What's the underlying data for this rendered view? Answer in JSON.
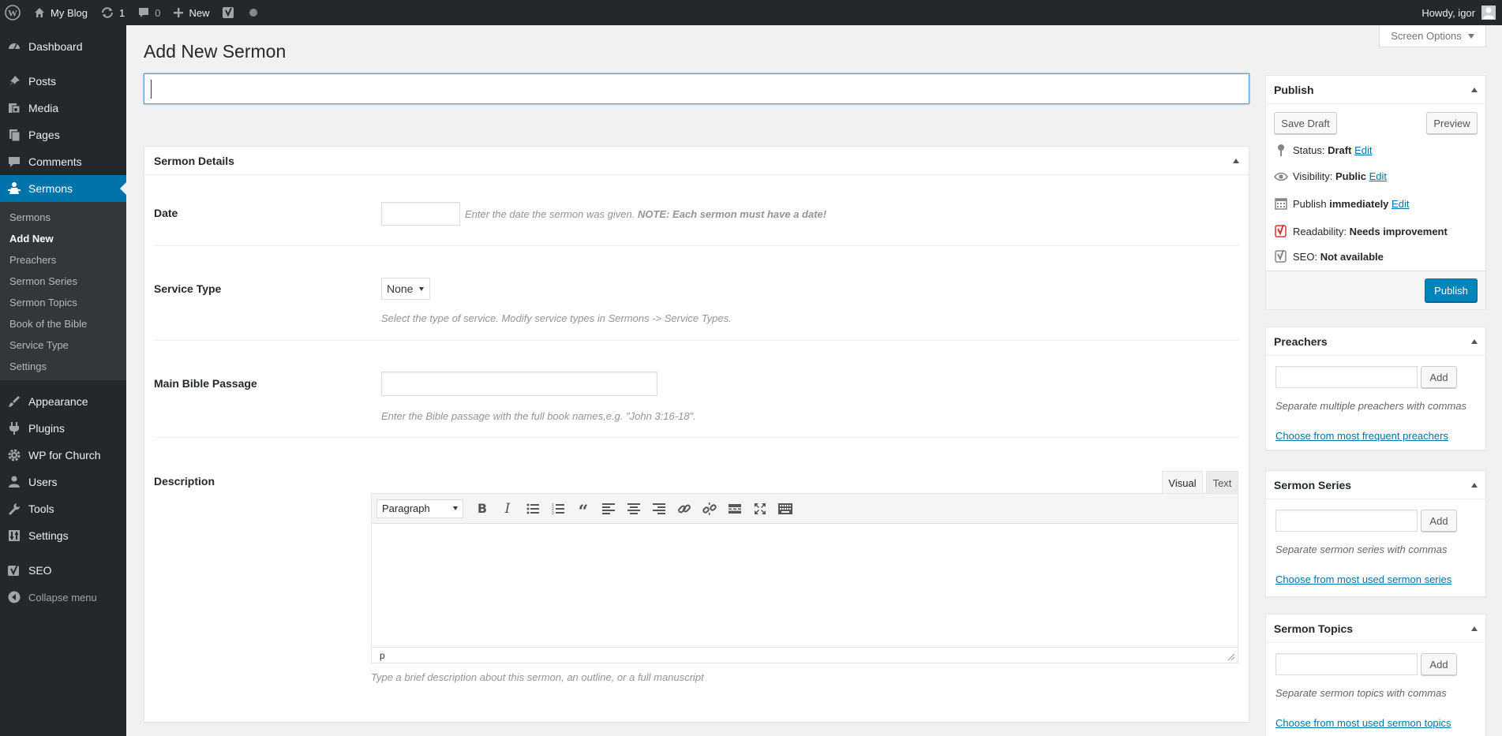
{
  "adminbar": {
    "site_name": "My Blog",
    "updates_count": "1",
    "comments_count": "0",
    "new_label": "New",
    "howdy": "Howdy, igor"
  },
  "sidebar": {
    "items": [
      {
        "label": "Dashboard",
        "icon": "dashboard-icon"
      },
      {
        "label": "Posts",
        "icon": "pin-icon"
      },
      {
        "label": "Media",
        "icon": "media-icon"
      },
      {
        "label": "Pages",
        "icon": "pages-icon"
      },
      {
        "label": "Comments",
        "icon": "comment-icon"
      },
      {
        "label": "Sermons",
        "icon": "person-icon"
      },
      {
        "label": "Appearance",
        "icon": "brush-icon"
      },
      {
        "label": "Plugins",
        "icon": "plugin-icon"
      },
      {
        "label": "WP for Church",
        "icon": "gear-icon"
      },
      {
        "label": "Users",
        "icon": "user-icon"
      },
      {
        "label": "Tools",
        "icon": "wrench-icon"
      },
      {
        "label": "Settings",
        "icon": "settings-icon"
      },
      {
        "label": "SEO",
        "icon": "yoast-icon"
      },
      {
        "label": "Collapse menu",
        "icon": "collapse-icon"
      }
    ],
    "submenu": [
      "Sermons",
      "Add New",
      "Preachers",
      "Sermon Series",
      "Sermon Topics",
      "Book of the Bible",
      "Service Type",
      "Settings"
    ]
  },
  "screen_options": "Screen Options",
  "page_title": "Add New Sermon",
  "title_input": {
    "value": ""
  },
  "details": {
    "title": "Sermon Details",
    "date_label": "Date",
    "date_help": "Enter the date the sermon was given. ",
    "date_help_bold": "NOTE: Each sermon must have a date!",
    "service_label": "Service Type",
    "service_value": "None",
    "service_help": "Select the type of service. Modify service types in Sermons -> Service Types.",
    "passage_label": "Main Bible Passage",
    "passage_help": "Enter the Bible passage with the full book names,e.g. \"John 3:16-18\".",
    "desc_label": "Description",
    "tab_visual": "Visual",
    "tab_text": "Text",
    "format_value": "Paragraph",
    "editor_path": "p",
    "desc_help": "Type a brief description about this sermon, an outline, or a full manuscript"
  },
  "publish": {
    "title": "Publish",
    "save_draft": "Save Draft",
    "preview": "Preview",
    "status_label": "Status: ",
    "status_value": "Draft",
    "visibility_label": "Visibility: ",
    "visibility_value": "Public",
    "publish_label": "Publish ",
    "publish_value": "immediately",
    "edit": "Edit",
    "readability_label": "Readability: ",
    "readability_value": "Needs improvement",
    "seo_label": "SEO: ",
    "seo_value": "Not available",
    "publish_button": "Publish"
  },
  "preachers": {
    "title": "Preachers",
    "add": "Add",
    "help": "Separate multiple preachers with commas",
    "link": "Choose from most frequent preachers"
  },
  "series": {
    "title": "Sermon Series",
    "add": "Add",
    "help": "Separate sermon series with commas",
    "link": "Choose from most used sermon series"
  },
  "topics": {
    "title": "Sermon Topics",
    "add": "Add",
    "help": "Separate sermon topics with commas",
    "link": "Choose from most used sermon topics"
  },
  "colors": {
    "adminbar_bg": "#23282d",
    "active_menu": "#0073aa",
    "primary_button": "#0085ba",
    "link": "#0073aa",
    "readability_red": "#dc3232"
  }
}
